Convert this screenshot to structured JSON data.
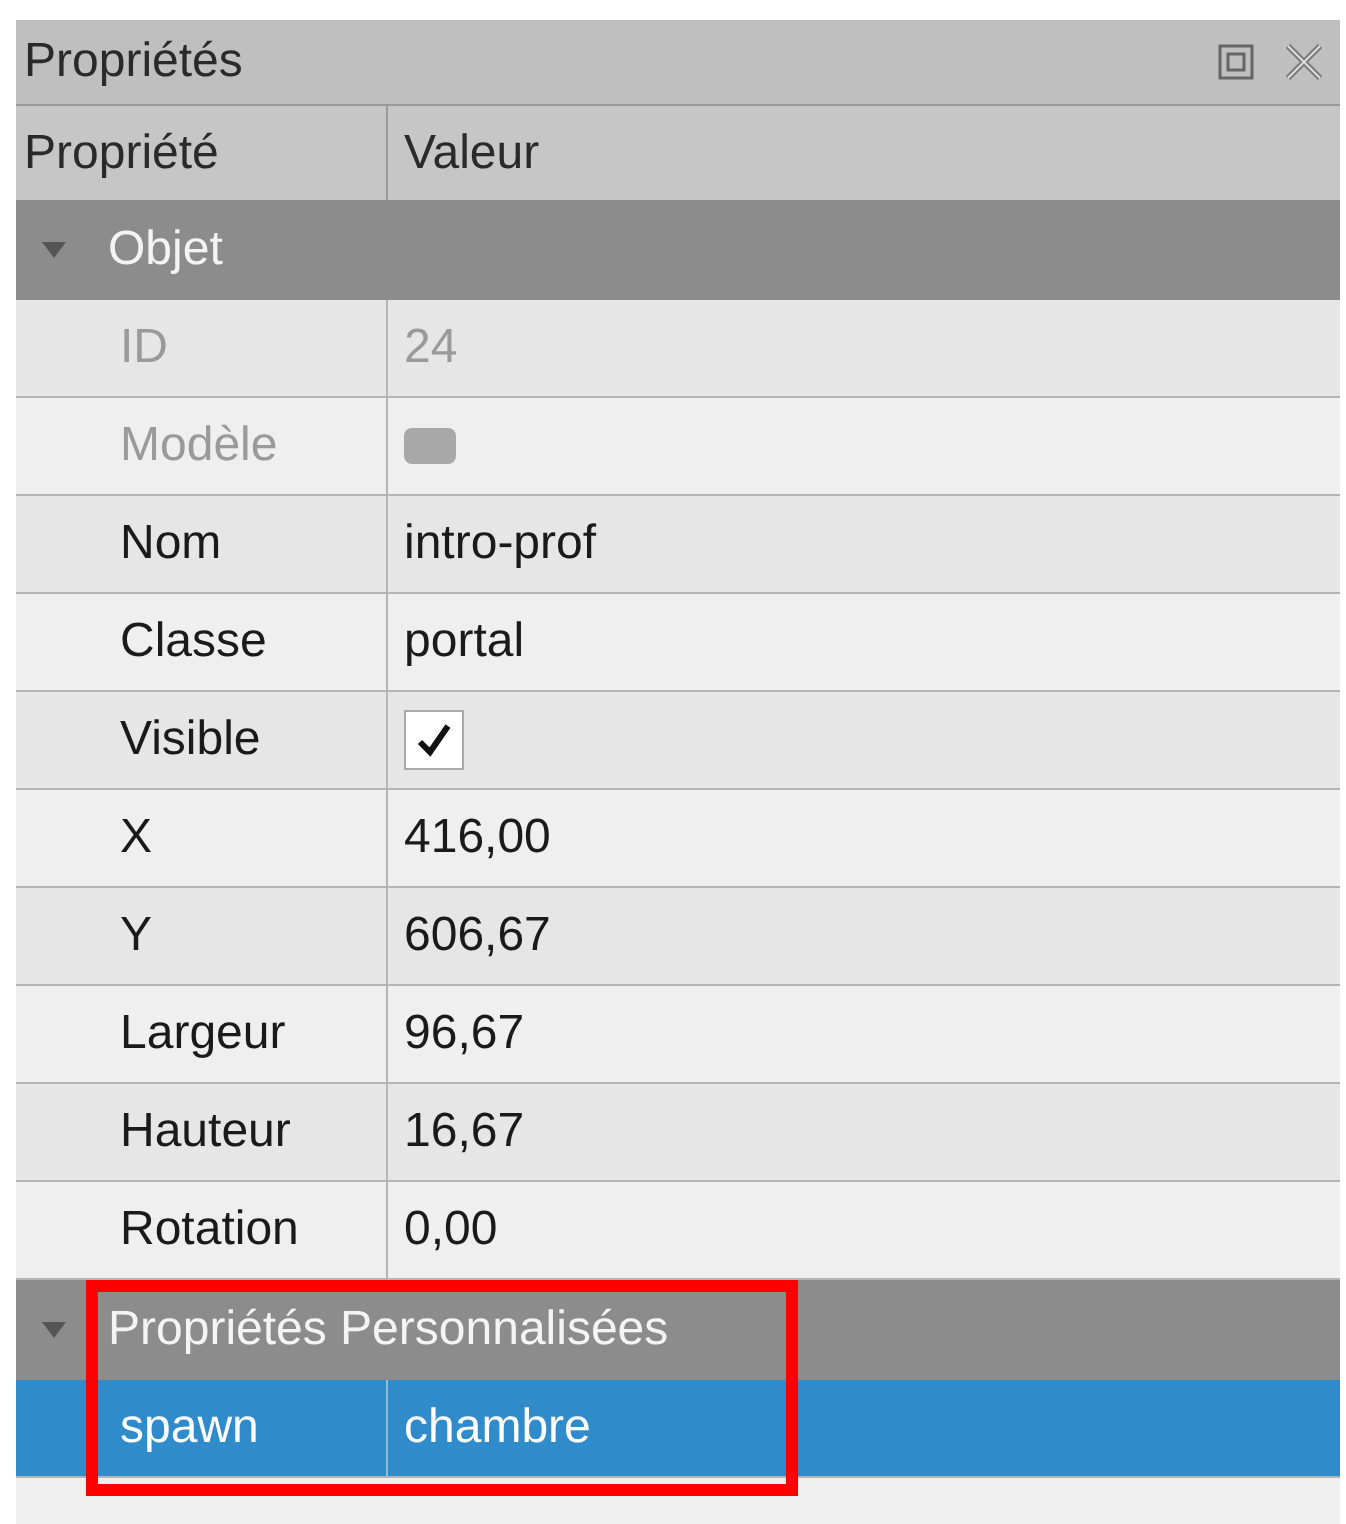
{
  "panel": {
    "title": "Propriétés"
  },
  "columns": [
    "Propriété",
    "Valeur"
  ],
  "groups": [
    {
      "title": "Objet",
      "expanded": true,
      "highlighted": false,
      "rows": [
        {
          "name": "ID",
          "value": "24",
          "kind": "text",
          "disabled": true,
          "selected": false
        },
        {
          "name": "Modèle",
          "kind": "swatch",
          "disabled": true,
          "selected": false
        },
        {
          "name": "Nom",
          "value": "intro-prof",
          "kind": "text",
          "disabled": false,
          "selected": false
        },
        {
          "name": "Classe",
          "value": "portal",
          "kind": "text",
          "disabled": false,
          "selected": false
        },
        {
          "name": "Visible",
          "kind": "checkbox",
          "checked": true,
          "disabled": false,
          "selected": false
        },
        {
          "name": "X",
          "value": "416,00",
          "kind": "text",
          "disabled": false,
          "selected": false
        },
        {
          "name": "Y",
          "value": "606,67",
          "kind": "text",
          "disabled": false,
          "selected": false
        },
        {
          "name": "Largeur",
          "value": "96,67",
          "kind": "text",
          "disabled": false,
          "selected": false
        },
        {
          "name": "Hauteur",
          "value": "16,67",
          "kind": "text",
          "disabled": false,
          "selected": false
        },
        {
          "name": "Rotation",
          "value": "0,00",
          "kind": "text",
          "disabled": false,
          "selected": false
        }
      ]
    },
    {
      "title": "Propriétés Personnalisées",
      "expanded": true,
      "highlighted": true,
      "rows": [
        {
          "name": "spawn",
          "value": "chambre",
          "kind": "text",
          "disabled": false,
          "selected": true
        }
      ]
    }
  ]
}
